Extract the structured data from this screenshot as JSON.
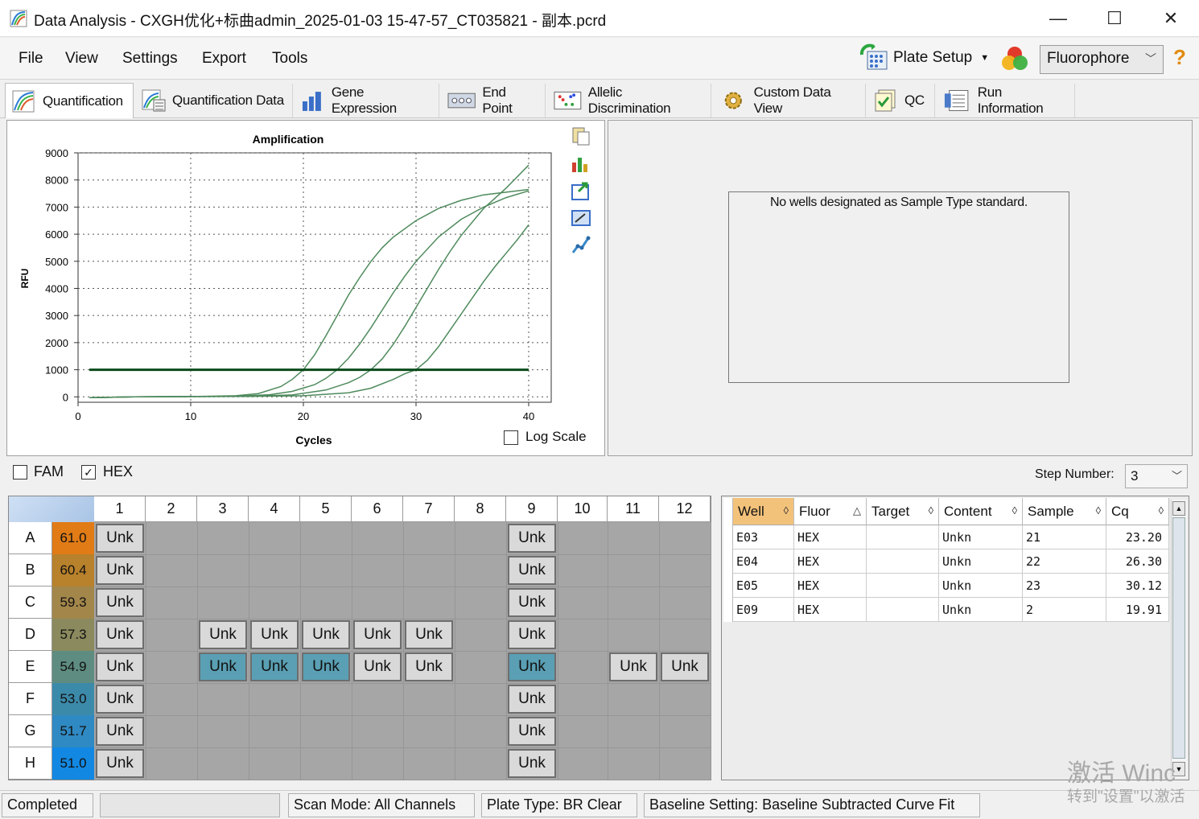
{
  "window": {
    "title": "Data Analysis - CXGH优化+标曲admin_2025-01-03 15-47-57_CT035821 - 副本.pcrd",
    "minimize": "—",
    "maximize": "☐",
    "close": "✕"
  },
  "menu": [
    "File",
    "View",
    "Settings",
    "Export",
    "Tools"
  ],
  "toolbar": {
    "plate_setup": "Plate Setup",
    "fluorophore": "Fluorophore",
    "help": "?"
  },
  "tabs": [
    "Quantification",
    "Quantification Data",
    "Gene Expression",
    "End Point",
    "Allelic Discrimination",
    "Custom Data View",
    "QC",
    "Run Information"
  ],
  "chart_data": {
    "type": "line",
    "title": "Amplification",
    "xlabel": "Cycles",
    "ylabel": "RFU",
    "xlim": [
      0,
      42
    ],
    "ylim": [
      -200,
      9000
    ],
    "xticks": [
      0,
      10,
      20,
      30,
      40
    ],
    "yticks": [
      0,
      1000,
      2000,
      3000,
      4000,
      5000,
      6000,
      7000,
      8000,
      9000
    ],
    "grid": true,
    "threshold": 1000,
    "series": [
      {
        "values": [
          [
            1,
            -30
          ],
          [
            5,
            0
          ],
          [
            10,
            10
          ],
          [
            14,
            40
          ],
          [
            16,
            120
          ],
          [
            18,
            380
          ],
          [
            19,
            640
          ],
          [
            20,
            1000
          ],
          [
            21,
            1550
          ],
          [
            22,
            2250
          ],
          [
            23,
            3000
          ],
          [
            24,
            3750
          ],
          [
            25,
            4400
          ],
          [
            26,
            5000
          ],
          [
            27,
            5500
          ],
          [
            28,
            5900
          ],
          [
            30,
            6500
          ],
          [
            32,
            6950
          ],
          [
            34,
            7250
          ],
          [
            36,
            7450
          ],
          [
            38,
            7550
          ],
          [
            40,
            7650
          ]
        ]
      },
      {
        "values": [
          [
            1,
            -30
          ],
          [
            5,
            0
          ],
          [
            10,
            10
          ],
          [
            14,
            20
          ],
          [
            17,
            80
          ],
          [
            19,
            200
          ],
          [
            21,
            450
          ],
          [
            22,
            680
          ],
          [
            23,
            1000
          ],
          [
            24,
            1420
          ],
          [
            25,
            1950
          ],
          [
            26,
            2550
          ],
          [
            27,
            3200
          ],
          [
            28,
            3850
          ],
          [
            29,
            4450
          ],
          [
            30,
            5000
          ],
          [
            32,
            5900
          ],
          [
            34,
            6550
          ],
          [
            36,
            7000
          ],
          [
            38,
            7350
          ],
          [
            40,
            7600
          ]
        ]
      },
      {
        "values": [
          [
            1,
            -30
          ],
          [
            5,
            0
          ],
          [
            10,
            10
          ],
          [
            15,
            20
          ],
          [
            19,
            70
          ],
          [
            22,
            250
          ],
          [
            24,
            520
          ],
          [
            25,
            720
          ],
          [
            26,
            1000
          ],
          [
            27,
            1400
          ],
          [
            28,
            1950
          ],
          [
            29,
            2600
          ],
          [
            30,
            3300
          ],
          [
            31,
            4000
          ],
          [
            32,
            4700
          ],
          [
            33,
            5350
          ],
          [
            34,
            5950
          ],
          [
            36,
            6950
          ],
          [
            38,
            7700
          ],
          [
            40,
            8550
          ]
        ]
      },
      {
        "values": [
          [
            1,
            -30
          ],
          [
            5,
            0
          ],
          [
            10,
            10
          ],
          [
            15,
            15
          ],
          [
            20,
            40
          ],
          [
            24,
            150
          ],
          [
            26,
            320
          ],
          [
            28,
            650
          ],
          [
            29,
            850
          ],
          [
            30,
            1000
          ],
          [
            31,
            1350
          ],
          [
            32,
            1850
          ],
          [
            33,
            2450
          ],
          [
            34,
            3050
          ],
          [
            35,
            3650
          ],
          [
            36,
            4250
          ],
          [
            37,
            4800
          ],
          [
            38,
            5300
          ],
          [
            39,
            5800
          ],
          [
            40,
            6350
          ]
        ]
      }
    ]
  },
  "chart": {
    "log_scale_label": "Log Scale"
  },
  "standard_panel": {
    "message": "No wells designated as Sample Type standard."
  },
  "fluor_filter": {
    "fam_label": "FAM",
    "hex_label": "HEX",
    "step_label": "Step Number:",
    "step_value": "3"
  },
  "plate": {
    "columns": [
      "1",
      "2",
      "3",
      "4",
      "5",
      "6",
      "7",
      "8",
      "9",
      "10",
      "11",
      "12"
    ],
    "rows": [
      {
        "label": "A",
        "temp": "61.0",
        "color": "#e07b16"
      },
      {
        "label": "B",
        "temp": "60.4",
        "color": "#b8812b"
      },
      {
        "label": "C",
        "temp": "59.3",
        "color": "#a2864a"
      },
      {
        "label": "D",
        "temp": "57.3",
        "color": "#8a8a5e"
      },
      {
        "label": "E",
        "temp": "54.9",
        "color": "#5e8c80"
      },
      {
        "label": "F",
        "temp": "53.0",
        "color": "#3c8aaa"
      },
      {
        "label": "G",
        "temp": "51.7",
        "color": "#2f89c2"
      },
      {
        "label": "H",
        "temp": "51.0",
        "color": "#1288e2"
      }
    ],
    "well_label": "Unk"
  },
  "results": {
    "headers": [
      "Well",
      "Fluor",
      "Target",
      "Content",
      "Sample",
      "Cq"
    ],
    "rows": [
      [
        "E03",
        "HEX",
        "",
        "Unkn",
        "21",
        "23.20"
      ],
      [
        "E04",
        "HEX",
        "",
        "Unkn",
        "22",
        "26.30"
      ],
      [
        "E05",
        "HEX",
        "",
        "Unkn",
        "23",
        "30.12"
      ],
      [
        "E09",
        "HEX",
        "",
        "Unkn",
        "2",
        "19.91"
      ]
    ]
  },
  "status": {
    "state": "Completed",
    "scan_mode": "Scan Mode: All Channels",
    "plate_type": "Plate Type: BR Clear",
    "baseline": "Baseline Setting: Baseline Subtracted Curve Fit"
  },
  "watermark": {
    "line1": "激活 Winc",
    "line2": "转到\"设置\"以激活"
  }
}
